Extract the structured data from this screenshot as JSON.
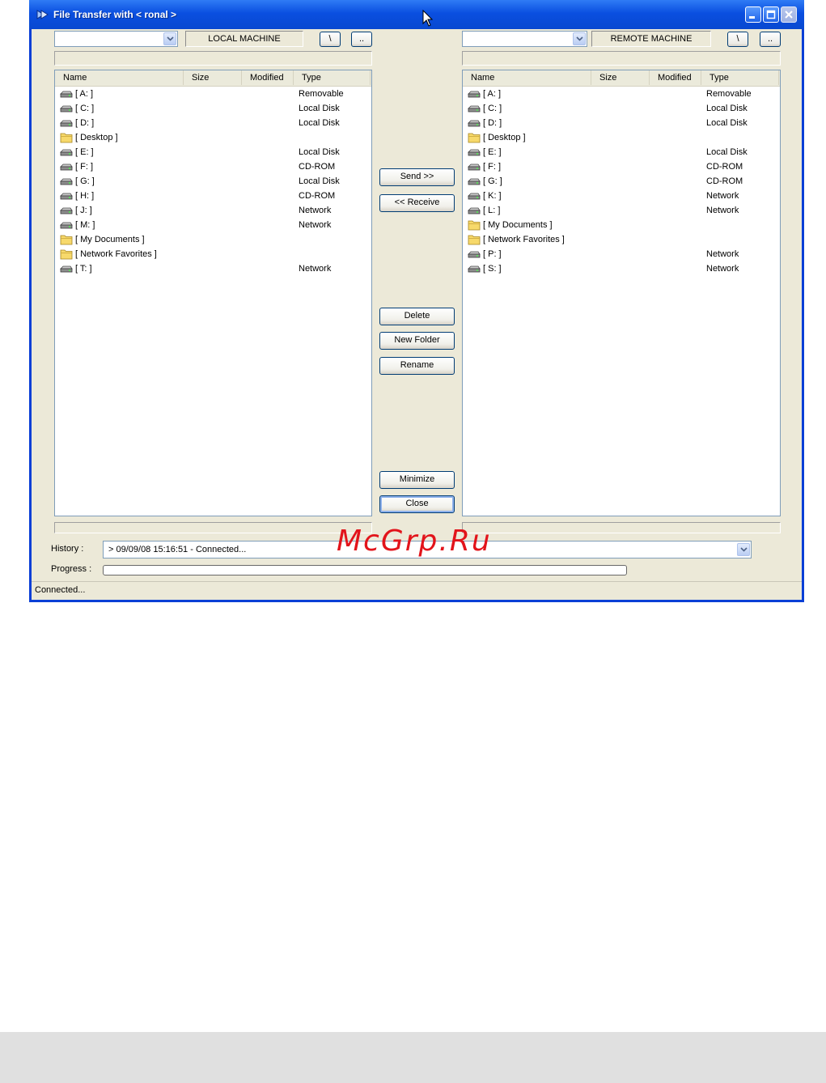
{
  "window": {
    "title": "File Transfer with < ronal >"
  },
  "local": {
    "label": "LOCAL MACHINE",
    "root_button": "\\",
    "up_button": "..",
    "columns": [
      "Name",
      "Size",
      "Modified",
      "Type"
    ],
    "items": [
      {
        "name": "[ A: ]",
        "type": "Removable",
        "icon": "drive-icon"
      },
      {
        "name": "[ C: ]",
        "type": "Local Disk",
        "icon": "drive-icon"
      },
      {
        "name": "[ D: ]",
        "type": "Local Disk",
        "icon": "drive-icon"
      },
      {
        "name": "[ Desktop ]",
        "type": "",
        "icon": "folder-icon"
      },
      {
        "name": "[ E: ]",
        "type": "Local Disk",
        "icon": "drive-icon"
      },
      {
        "name": "[ F: ]",
        "type": "CD-ROM",
        "icon": "drive-icon"
      },
      {
        "name": "[ G: ]",
        "type": "Local Disk",
        "icon": "drive-icon"
      },
      {
        "name": "[ H: ]",
        "type": "CD-ROM",
        "icon": "drive-icon"
      },
      {
        "name": "[ J: ]",
        "type": "Network",
        "icon": "drive-icon"
      },
      {
        "name": "[ M: ]",
        "type": "Network",
        "icon": "drive-icon"
      },
      {
        "name": "[ My Documents ]",
        "type": "",
        "icon": "folder-icon"
      },
      {
        "name": "[ Network Favorites ]",
        "type": "",
        "icon": "folder-icon"
      },
      {
        "name": "[ T: ]",
        "type": "Network",
        "icon": "drive-icon"
      }
    ]
  },
  "remote": {
    "label": "REMOTE MACHINE",
    "root_button": "\\",
    "up_button": "..",
    "columns": [
      "Name",
      "Size",
      "Modified",
      "Type"
    ],
    "items": [
      {
        "name": "[ A: ]",
        "type": "Removable",
        "icon": "drive-icon"
      },
      {
        "name": "[ C: ]",
        "type": "Local Disk",
        "icon": "drive-icon"
      },
      {
        "name": "[ D: ]",
        "type": "Local Disk",
        "icon": "drive-icon"
      },
      {
        "name": "[ Desktop ]",
        "type": "",
        "icon": "folder-icon"
      },
      {
        "name": "[ E: ]",
        "type": "Local Disk",
        "icon": "drive-icon"
      },
      {
        "name": "[ F: ]",
        "type": "CD-ROM",
        "icon": "drive-icon"
      },
      {
        "name": "[ G: ]",
        "type": "CD-ROM",
        "icon": "drive-icon"
      },
      {
        "name": "[ K: ]",
        "type": "Network",
        "icon": "drive-icon"
      },
      {
        "name": "[ L: ]",
        "type": "Network",
        "icon": "drive-icon"
      },
      {
        "name": "[ My Documents ]",
        "type": "",
        "icon": "folder-icon"
      },
      {
        "name": "[ Network Favorites ]",
        "type": "",
        "icon": "folder-icon"
      },
      {
        "name": "[ P: ]",
        "type": "Network",
        "icon": "drive-icon"
      },
      {
        "name": "[ S: ]",
        "type": "Network",
        "icon": "drive-icon"
      }
    ]
  },
  "actions": {
    "send": "Send >>",
    "receive": "<< Receive",
    "delete": "Delete",
    "new_folder": "New Folder",
    "rename": "Rename",
    "minimize": "Minimize",
    "close": "Close"
  },
  "bottom": {
    "history_label": "History :",
    "history_value": "> 09/09/08 15:16:51 -  Connected...",
    "progress_label": "Progress :",
    "progress_value": 0
  },
  "status": {
    "text": "Connected..."
  },
  "watermark": {
    "text": "McGrp.Ru"
  },
  "colors": {
    "titlebar": "#0a4fe0",
    "window_face": "#ece9d8",
    "watermark": "#e2141b"
  }
}
